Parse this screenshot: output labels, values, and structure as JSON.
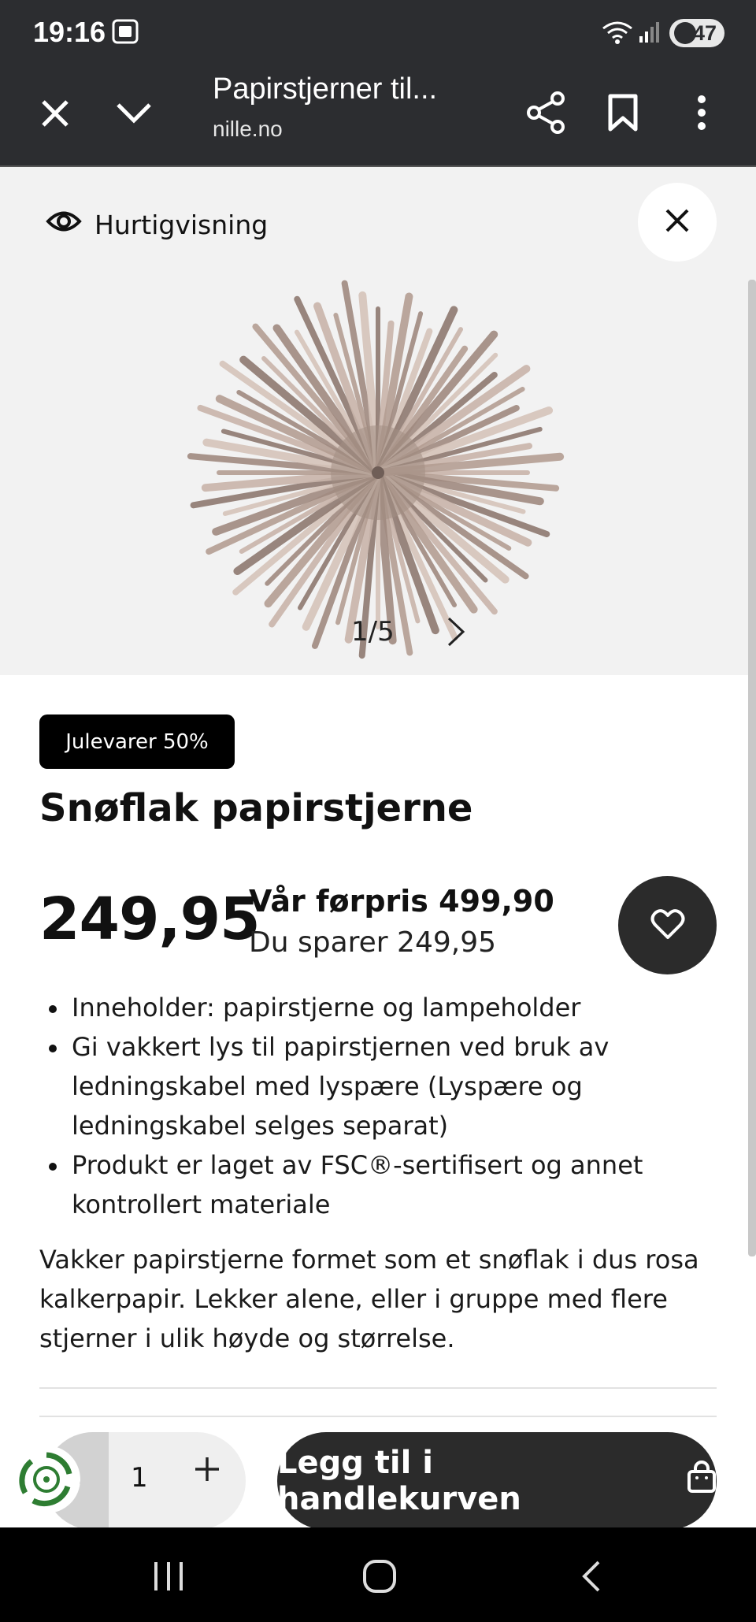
{
  "status_bar": {
    "time": "19:16",
    "battery": "47"
  },
  "browser": {
    "page_title": "Papirstjerner til...",
    "domain": "nille.no"
  },
  "quickview": {
    "label": "Hurtigvisning"
  },
  "gallery": {
    "counter": "1/5"
  },
  "product": {
    "badge": "Julevarer 50%",
    "title": "Snøflak papirstjerne",
    "price": "249,95",
    "previous_price": "Vår førpris 499,90",
    "savings": "Du sparer 249,95",
    "bullets": [
      "Inneholder: papirstjerne og lampeholder",
      "Gi vakkert lys til papirstjernen ved bruk av ledningskabel med lyspære (Lyspære og ledningskabel selges separat)",
      "Produkt er laget av FSC®-sertifisert og annet kontrollert materiale"
    ],
    "description": "Vakker papirstjerne formet som et snøflak i dus rosa kalkerpapir. Lekker alene, eller i gruppe med flere stjerner i ulik høyde og størrelse."
  },
  "cart": {
    "quantity": "1",
    "minus": "-",
    "add_label": "Legg til i handlekurven"
  },
  "colors": {
    "dark": "#2b2b2b",
    "browser_bar": "#2c2d30",
    "gallery_bg": "#f2f2f2",
    "star": "#b49e93"
  }
}
